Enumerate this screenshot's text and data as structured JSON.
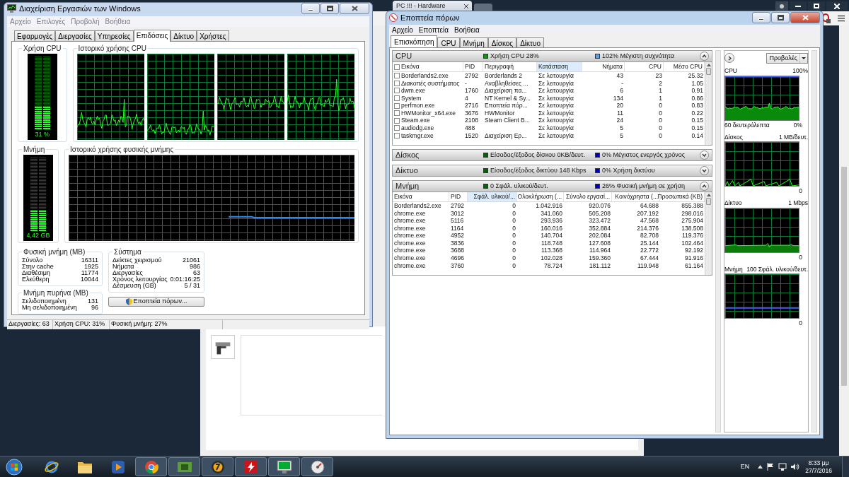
{
  "browser": {
    "tab_title": "PC !!! - Hardware"
  },
  "task_manager": {
    "title": "Διαχείριση Εργασιών των Windows",
    "active": false,
    "menu": [
      "Αρχείο",
      "Επιλογές",
      "Προβολή",
      "Βοήθεια"
    ],
    "tabs": [
      {
        "label": "Εφαρμογές",
        "selected": false
      },
      {
        "label": "Διεργασίες",
        "selected": false
      },
      {
        "label": "Υπηρεσίες",
        "selected": false
      },
      {
        "label": "Επιδόσεις",
        "selected": true
      },
      {
        "label": "Δίκτυο",
        "selected": false
      },
      {
        "label": "Χρήστες",
        "selected": false
      }
    ],
    "cpu_usage": {
      "label": "Χρήση CPU",
      "reading": "31 %",
      "level": 0.31
    },
    "cpu_history": {
      "label": "Ιστορικό χρήσης CPU"
    },
    "memory": {
      "label": "Μνήμη",
      "reading": "4,42 GB",
      "level": 0.27
    },
    "memory_history": {
      "label": "Ιστορικό χρήσης φυσικής μνήμης"
    },
    "physical_memory": {
      "label": "Φυσική μνήμη (MB)",
      "rows": [
        {
          "name": "Σύνολο",
          "value": "16311"
        },
        {
          "name": "Στην cache",
          "value": "1925"
        },
        {
          "name": "Διαθέσιμη",
          "value": "11774"
        },
        {
          "name": "Ελεύθερη",
          "value": "10044"
        }
      ]
    },
    "kernel_memory": {
      "label": "Μνήμη πυρήνα (MB)",
      "rows": [
        {
          "name": "Σελιδοποιημένη",
          "value": "131"
        },
        {
          "name": "Μη σελιδοποιημένη",
          "value": "96"
        }
      ]
    },
    "system": {
      "label": "Σύστημα",
      "rows": [
        {
          "name": "Δείκτες χειρισμού",
          "value": "21061"
        },
        {
          "name": "Νήματα",
          "value": "986"
        },
        {
          "name": "Διεργασίες",
          "value": "63"
        },
        {
          "name": "Χρόνος λειτουργίας",
          "value": "0:01:16:25"
        },
        {
          "name": "Δέσμευση (GB)",
          "value": "5 / 31"
        }
      ]
    },
    "resource_monitor_button": "Εποπτεία πόρων...",
    "status_bar": [
      "Διεργασίες: 63",
      "Χρήση CPU: 31%",
      "Φυσική μνήμη: 27%"
    ]
  },
  "resource_monitor": {
    "title": "Εποπτεία πόρων",
    "active": true,
    "menu": [
      "Αρχείο",
      "Εποπτεία",
      "Βοήθεια"
    ],
    "tabs": [
      {
        "label": "Επισκόπηση",
        "selected": true
      },
      {
        "label": "CPU",
        "selected": false
      },
      {
        "label": "Μνήμη",
        "selected": false
      },
      {
        "label": "Δίσκος",
        "selected": false
      },
      {
        "label": "Δίκτυο",
        "selected": false
      }
    ],
    "sections": [
      {
        "title": "CPU",
        "expanded": true,
        "legend": [
          {
            "text": "Χρήση CPU 28%",
            "color": "#00a000"
          },
          {
            "text": "102% Μέγιστη συχνότητα",
            "color": "#5ea0ef"
          }
        ],
        "table": {
          "columns": [
            {
              "label": "Εικόνα",
              "sorted": false
            },
            {
              "label": "PID",
              "sorted": false
            },
            {
              "label": "Περιγραφή",
              "sorted": false
            },
            {
              "label": "Κατάσταση",
              "sorted": true
            },
            {
              "label": "Νήματα",
              "sorted": false
            },
            {
              "label": "CPU",
              "sorted": false
            },
            {
              "label": "Μέσο CPU",
              "sorted": false
            }
          ],
          "rows": [
            {
              "checked": false,
              "cells": [
                "Borderlands2.exe",
                "2792",
                "Borderlands 2",
                "Σε λειτουργία",
                "43",
                "23",
                "25.32"
              ]
            },
            {
              "checked": false,
              "cells": [
                "Διακοπές συστήματος",
                "-",
                "Αναβληθείσες ...",
                "Σε λειτουργία",
                "-",
                "2",
                "1.05"
              ]
            },
            {
              "checked": false,
              "cells": [
                "dwm.exe",
                "1760",
                "Διαχείριση πα...",
                "Σε λειτουργία",
                "6",
                "1",
                "0.91"
              ]
            },
            {
              "checked": false,
              "cells": [
                "System",
                "4",
                "NT Kernel & Sy...",
                "Σε λειτουργία",
                "134",
                "1",
                "0.86"
              ]
            },
            {
              "checked": false,
              "cells": [
                "perfmon.exe",
                "2716",
                "Εποπτεία πόρ...",
                "Σε λειτουργία",
                "20",
                "0",
                "0.83"
              ]
            },
            {
              "checked": false,
              "cells": [
                "HWMonitor_x64.exe",
                "3676",
                "HWMonitor",
                "Σε λειτουργία",
                "11",
                "0",
                "0.22"
              ]
            },
            {
              "checked": false,
              "cells": [
                "Steam.exe",
                "2108",
                "Steam Client B...",
                "Σε λειτουργία",
                "24",
                "0",
                "0.15"
              ]
            },
            {
              "checked": false,
              "cells": [
                "audiodg.exe",
                "488",
                null,
                "Σε λειτουργία",
                "5",
                "0",
                "0.15"
              ]
            },
            {
              "checked": false,
              "cells": [
                "taskmgr.exe",
                "1520",
                "Διαχείριση Ερ...",
                "Σε λειτουργία",
                "5",
                "0",
                "0.14"
              ]
            }
          ]
        }
      },
      {
        "title": "Δίσκος",
        "expanded": false,
        "legend": [
          {
            "text": "Είσοδος/έξοδος δίσκου 0KB/δευτ.",
            "color": "#006400"
          },
          {
            "text": "0% Μέγιστος ενεργός χρόνος",
            "color": "#0000c0"
          }
        ]
      },
      {
        "title": "Δίκτυο",
        "expanded": false,
        "legend": [
          {
            "text": "Είσοδος/έξοδος δικτύου 148 Kbps",
            "color": "#006400"
          },
          {
            "text": "0% Χρήση δικτύου",
            "color": "#0000c0"
          }
        ]
      },
      {
        "title": "Μνήμη",
        "expanded": true,
        "legend": [
          {
            "text": "0 Σφάλ. υλικού/δευτ.",
            "color": "#006400"
          },
          {
            "text": "26% Φυσική μνήμη σε χρήση",
            "color": "#0000c0"
          }
        ],
        "table": {
          "columns": [
            {
              "label": "Εικόνα",
              "sorted": false
            },
            {
              "label": "PID",
              "sorted": false
            },
            {
              "label": "Σφάλ. υλικού/...",
              "sorted": true
            },
            {
              "label": "Ολοκλήρωση (...",
              "sorted": false
            },
            {
              "label": "Σύνολο εργασί...",
              "sorted": false
            },
            {
              "label": "Κοινόχρηστα (...",
              "sorted": false
            },
            {
              "label": "Προσωπικά (KB)",
              "sorted": false
            }
          ],
          "rows": [
            {
              "cells": [
                "Borderlands2.exe",
                "2792",
                "0",
                "1.042.916",
                "920.076",
                "64.688",
                "855.388"
              ]
            },
            {
              "cells": [
                "chrome.exe",
                "3012",
                "0",
                "341.060",
                "505.208",
                "207.192",
                "298.016"
              ]
            },
            {
              "cells": [
                "chrome.exe",
                "5116",
                "0",
                "293.936",
                "323.472",
                "47.568",
                "275.904"
              ]
            },
            {
              "cells": [
                "chrome.exe",
                "1164",
                "0",
                "160.016",
                "352.884",
                "214.376",
                "138.508"
              ]
            },
            {
              "cells": [
                "chrome.exe",
                "4952",
                "0",
                "140.704",
                "202.084",
                "82.708",
                "119.376"
              ]
            },
            {
              "cells": [
                "chrome.exe",
                "3836",
                "0",
                "118.748",
                "127.608",
                "25.144",
                "102.464"
              ]
            },
            {
              "cells": [
                "chrome.exe",
                "3688",
                "0",
                "113.368",
                "114.964",
                "22.772",
                "92.192"
              ]
            },
            {
              "cells": [
                "chrome.exe",
                "4696",
                "0",
                "102.028",
                "159.360",
                "67.444",
                "91.916"
              ]
            },
            {
              "cells": [
                "chrome.exe",
                "3760",
                "0",
                "78.724",
                "181.112",
                "119.948",
                "61.164"
              ]
            }
          ]
        }
      }
    ],
    "views_button": "Προβολές",
    "graphs": [
      {
        "title": "CPU",
        "max": "100%",
        "time": "60 δευτερόλεπτα",
        "min": "0%"
      },
      {
        "title": "Δίσκος",
        "max": "1 MB/δευτ.",
        "min": "0"
      },
      {
        "title": "Δίκτυο",
        "max": "1 Mbps",
        "min": "0"
      },
      {
        "title": "Μνήμη",
        "max": "100 Σφάλ. υλικού/δευτ.",
        "min": "0"
      }
    ]
  },
  "taskbar": {
    "apps": [
      {
        "running": false
      },
      {
        "running": false
      },
      {
        "running": false
      },
      {
        "running": true
      },
      {
        "running": true
      },
      {
        "running": true
      },
      {
        "running": true
      },
      {
        "running": true
      },
      {
        "running": true
      }
    ],
    "language": "EN",
    "time": "8:33 μμ",
    "date": "27/7/2016"
  }
}
